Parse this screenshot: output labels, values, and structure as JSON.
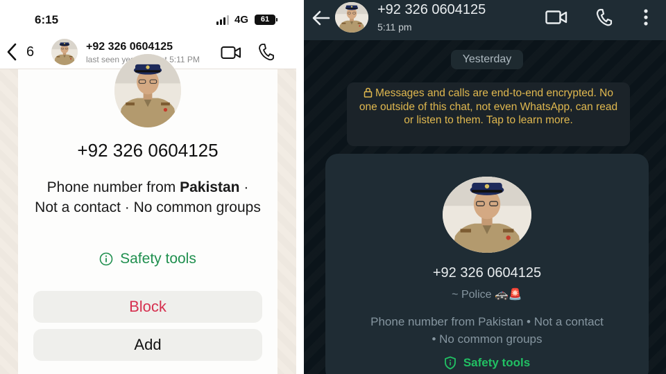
{
  "left": {
    "status": {
      "time": "6:15",
      "network": "4G",
      "battery": "61"
    },
    "header": {
      "back_count": "6",
      "name": "+92 326 0604125",
      "last_seen": "last seen yesterday at 5:11 PM"
    },
    "card": {
      "phone": "+92 326 0604125",
      "info_prefix": "Phone number from ",
      "info_country": "Pakistan",
      "info_suffix": " · Not a contact · No common groups",
      "safety_label": "Safety tools",
      "block_label": "Block",
      "add_label": "Add"
    }
  },
  "right": {
    "header": {
      "name": "+92 326 0604125",
      "time": "5:11 pm"
    },
    "date_chip": "Yesterday",
    "encryption_notice": "Messages and calls are end-to-end encrypted. No one outside of this chat, not even WhatsApp, can read or listen to them. Tap to learn more.",
    "card": {
      "phone": "+92 326 0604125",
      "about": "~ Police 🚓🚨",
      "info": "Phone number from Pakistan • Not a contact • No common groups",
      "safety_label": "Safety tools"
    }
  },
  "colors": {
    "ios_green": "#1f8f4e",
    "ios_red": "#d6304f",
    "wa_green": "#21c063",
    "wa_gold": "#e0b84f",
    "wa_dark": "#0b141a"
  },
  "icons": [
    "back-chevron-icon",
    "video-call-icon",
    "phone-call-icon",
    "info-icon",
    "shield-icon",
    "lock-icon",
    "back-arrow-icon",
    "more-options-icon",
    "signal-icon",
    "battery-icon"
  ]
}
